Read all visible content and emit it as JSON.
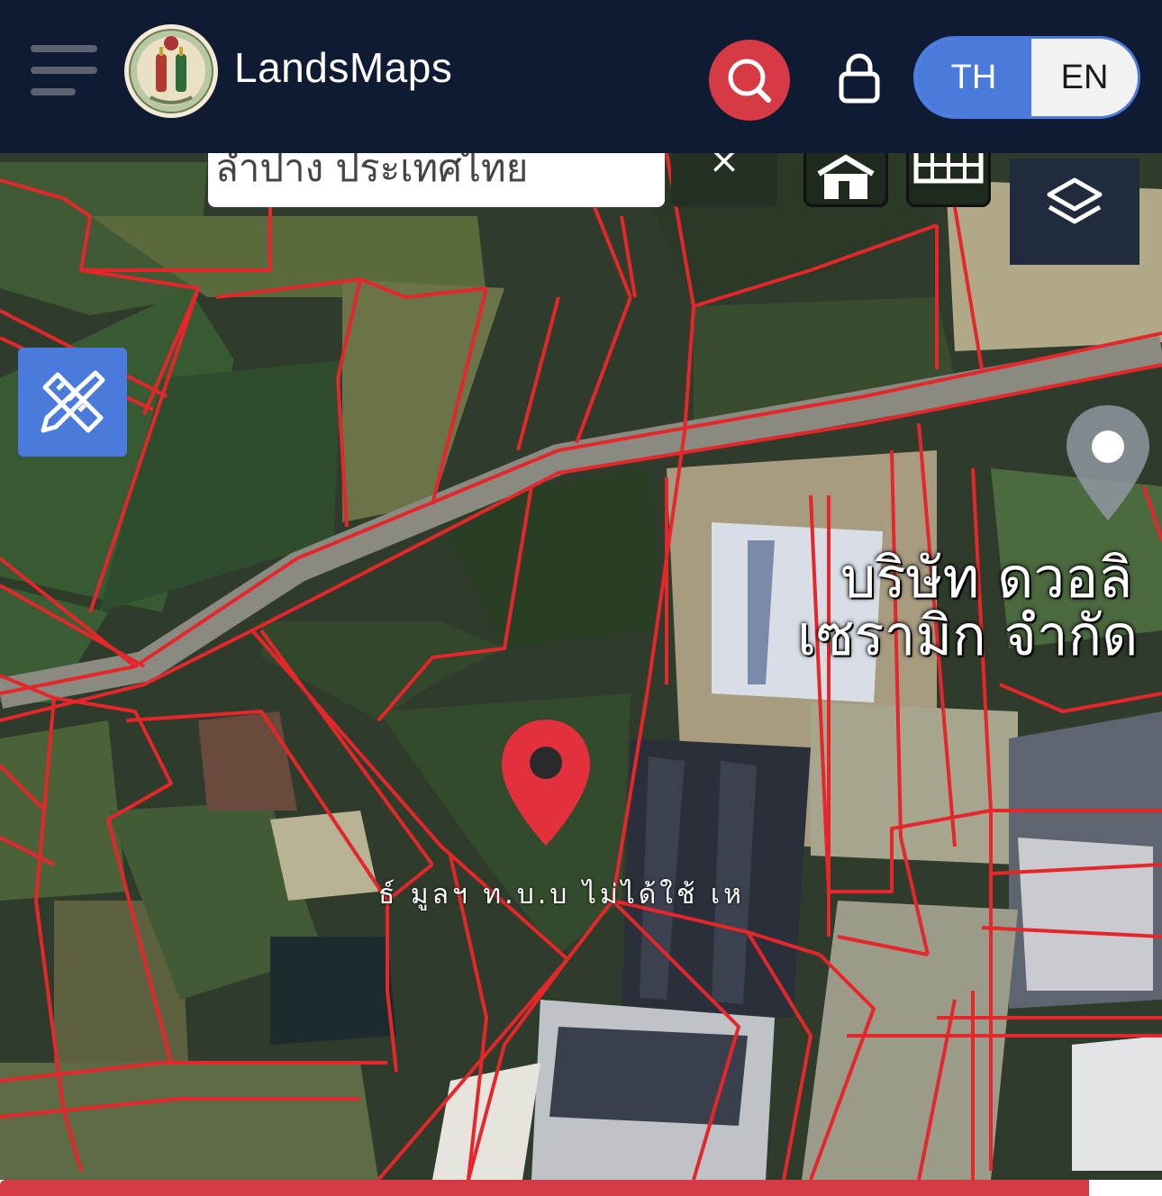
{
  "header": {
    "title": "LandsMaps",
    "language": {
      "options": [
        "TH",
        "EN"
      ],
      "selected": "TH"
    }
  },
  "search": {
    "value": "ลำปาง ประเทศไทย",
    "clear_label": "×"
  },
  "map": {
    "place_label_line1": "บริษัท ดวอลิ",
    "place_label_line2": "เซรามิก จำกัด",
    "parcel_label": "ธ์ มูลฯ ท.บ.บ ไม่ได้ใช้ เห",
    "parcel_color": "#e5262b"
  },
  "colors": {
    "header_bg": "#0e1b33",
    "accent": "#4a7bdc",
    "search_red": "#d63a45"
  },
  "icons": [
    "hamburger-icon",
    "logo-seal",
    "search-icon",
    "lock-icon",
    "close-icon",
    "building-icon",
    "grid-icon",
    "layers-icon",
    "ruler-pencil-icon",
    "location-pin-icon",
    "location-marker-icon"
  ],
  "progress": {
    "fraction": 0.937
  }
}
